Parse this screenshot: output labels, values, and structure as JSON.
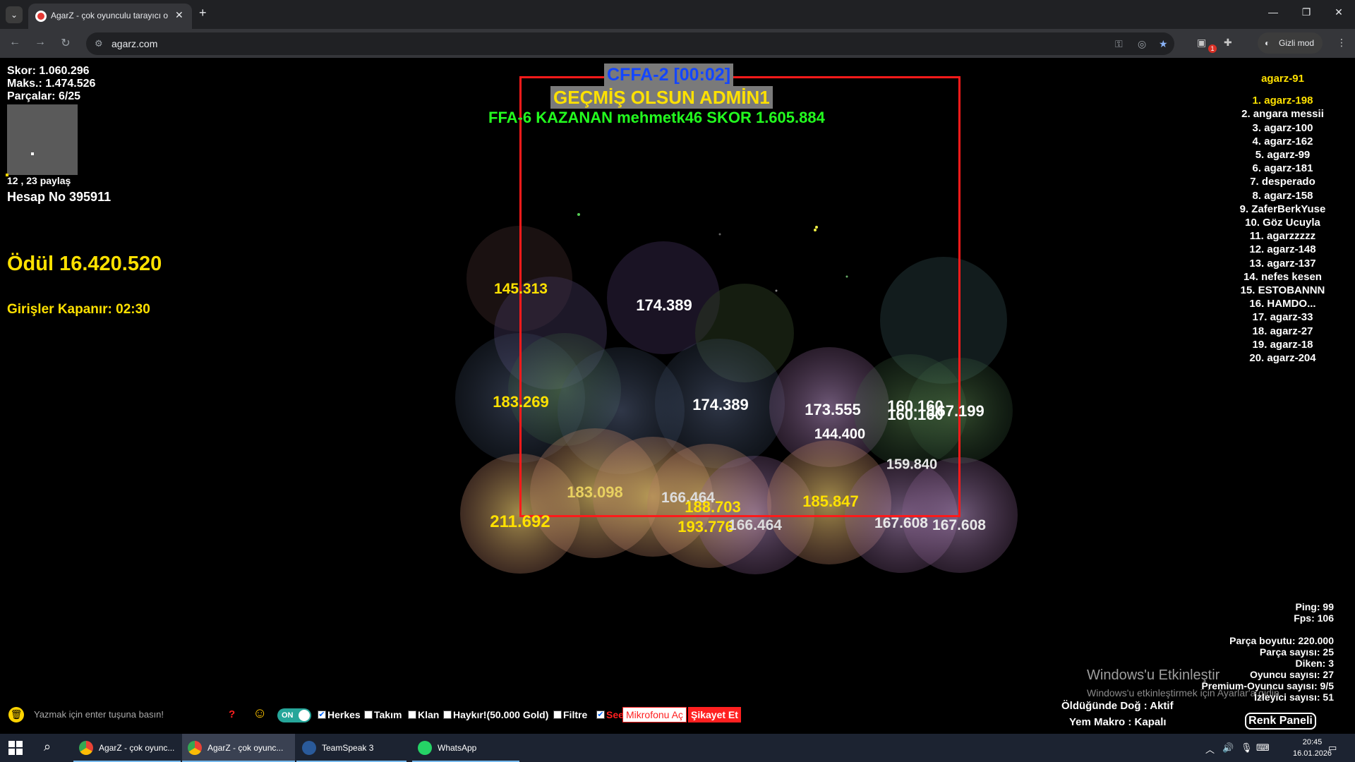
{
  "browser": {
    "tab_title": "AgarZ - çok oyunculu tarayıcı o",
    "url": "agarz.com",
    "incognito_label": "Gizli mod",
    "extension_badge": "1"
  },
  "game": {
    "stats": {
      "score": "Skor: 1.060.296",
      "max": "Maks.: 1.474.526",
      "pieces": "Parçalar: 6/25"
    },
    "coords": "12 , 23 paylaş",
    "account": "Hesap No 395911",
    "prize": "Ödül 16.420.520",
    "entry_close": "Girişler Kapanır: 02:30",
    "banner_mode": "CFFA-2 [00:02]",
    "banner_message": "GEÇMİŞ OLSUN  ADMİN1",
    "banner_winner": "FFA-6 KAZANAN mehmetk46 SKOR 1.605.884",
    "leaderboard": {
      "title": "agarz-91",
      "items": [
        "1. agarz-198",
        "2. angara messii",
        "3. agarz-100",
        "4. agarz-162",
        "5. agarz-99",
        "6. agarz-181",
        "7. desperado",
        "8. agarz-158",
        "9. ZaferBerkYuse",
        "10. Göz Ucuyla",
        "11. agarzzzzz",
        "12. agarz-148",
        "13. agarz-137",
        "14. nefes kesen",
        "15. ESTOBANNN",
        "16. HAMDO...",
        "17. agarz-33",
        "18. agarz-27",
        "19. agarz-18",
        "20. agarz-204"
      ]
    },
    "cell_labels": [
      "145.313",
      "174.389",
      "183.269",
      "174.389",
      "173.555",
      "160.160",
      "160.160",
      "167.199",
      "144.400",
      "159.840",
      "183.098",
      "166.464",
      "188.703",
      "185.847",
      "211.692",
      "193.776",
      "166.464",
      "167.608",
      "167.608"
    ],
    "server_stats": {
      "ping": "Ping: 99",
      "fps": "Fps: 106",
      "piece_size": "Parça boyutu: 220.000",
      "piece_count": "Parça sayısı: 25",
      "spikes": "Diken: 3",
      "players": "Oyuncu sayısı: 27",
      "premium": "Premium-Oyuncu sayısı: 9/5",
      "spectators": "İzleyici sayısı: 51"
    },
    "dog_status": "Öldüğünde Doğ : Aktif",
    "macro_status": "Yem Makro : Kapalı",
    "color_panel": "Renk Paneli"
  },
  "windows_activation": {
    "title": "Windows'u Etkinleştir",
    "subtitle": "Windows'u etkinleştirmek için Ayarlar'a gidin."
  },
  "chat": {
    "placeholder": "Yazmak için enter tuşuna basın!",
    "help": "?",
    "toggle": "ON",
    "checks": {
      "everyone": "Herkes",
      "team": "Takım",
      "clan": "Klan",
      "shout": "Haykır!(50.000 Gold)",
      "filter": "Filtre",
      "see": "See"
    },
    "mic_button": "Mikrofonu Aç",
    "report_button": "Şikayet Et"
  },
  "taskbar": {
    "apps": [
      "AgarZ - çok oyunc...",
      "AgarZ - çok oyunc...",
      "TeamSpeak 3",
      "WhatsApp"
    ],
    "time": "20:45",
    "date": "16.01.2026"
  },
  "colors": {
    "accent_yellow": "#ffe100",
    "arena_border": "#ff1a1a",
    "banner_blue": "#1446ff",
    "banner_green": "#23ff1f"
  }
}
